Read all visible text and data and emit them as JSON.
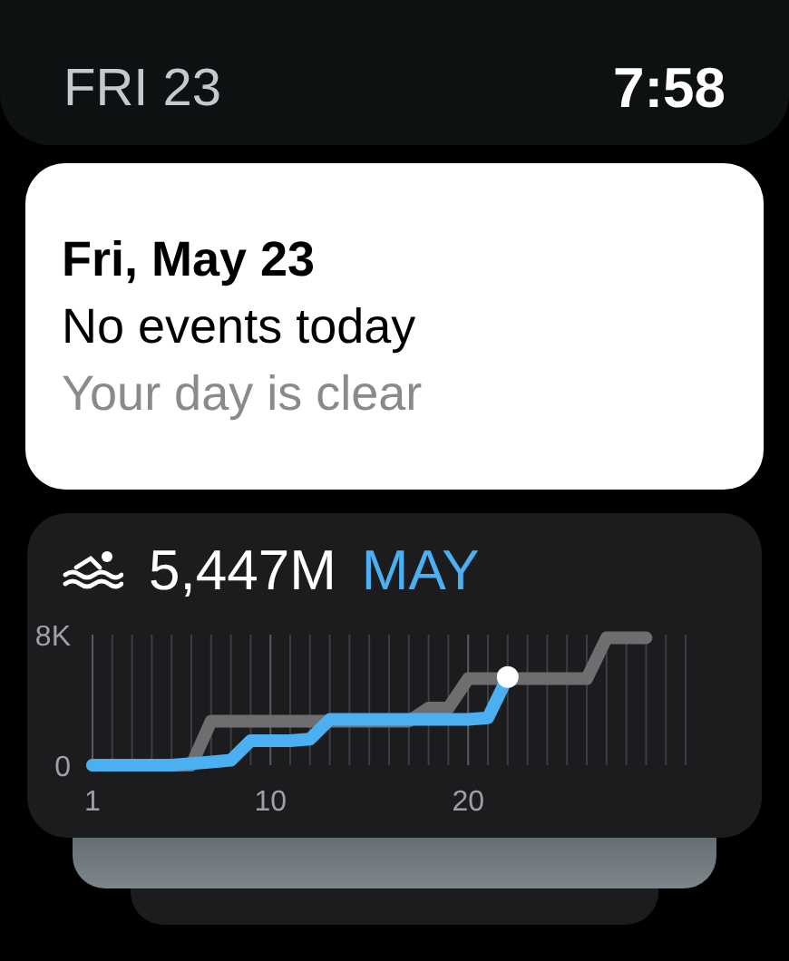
{
  "status_bar": {
    "date": "FRI 23",
    "time": "7:58"
  },
  "events_card": {
    "date": "Fri, May 23",
    "title": "No events today",
    "subtitle": "Your day is clear"
  },
  "activity_card": {
    "total": "5,447M",
    "period": "MAY",
    "chart_data": {
      "type": "line",
      "x": [
        1,
        2,
        3,
        4,
        5,
        6,
        7,
        8,
        9,
        10,
        11,
        12,
        13,
        14,
        15,
        16,
        17,
        18,
        19,
        20,
        21,
        22,
        23,
        24,
        25,
        26,
        27,
        28,
        29
      ],
      "xlim": [
        1,
        31
      ],
      "ylim": [
        0,
        8000
      ],
      "xticks": [
        1,
        10,
        20
      ],
      "yticks": [
        {
          "value": 0,
          "label": "0"
        },
        {
          "value": 8000,
          "label": "8K"
        }
      ],
      "series": [
        {
          "color": "#6e6e70",
          "values": [
            0,
            0,
            0,
            0,
            0,
            0,
            2700,
            2700,
            2700,
            2700,
            2700,
            2700,
            2700,
            2700,
            2700,
            2700,
            2700,
            3500,
            3500,
            5300,
            5300,
            5300,
            5300,
            5300,
            5300,
            5300,
            7800,
            7800,
            7800
          ]
        },
        {
          "color": "#4ab0f2",
          "values": [
            0,
            0,
            0,
            0,
            0,
            100,
            200,
            300,
            1500,
            1500,
            1500,
            1600,
            2800,
            2800,
            2800,
            2800,
            2800,
            2800,
            2800,
            2800,
            2900,
            5400,
            null,
            null,
            null,
            null,
            null,
            null,
            null
          ]
        }
      ]
    }
  }
}
